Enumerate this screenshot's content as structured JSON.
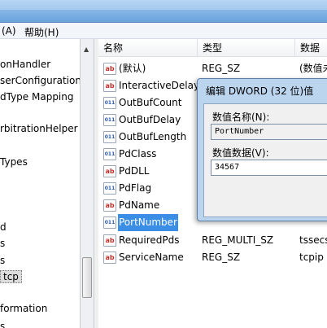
{
  "menu": {
    "items": [
      "(A)",
      "帮助(H)"
    ]
  },
  "tree": {
    "items": [
      "onHandler",
      "serConfiguration",
      "dType Mapping",
      "rbitrationHelper",
      "Types",
      "d",
      "s",
      "s",
      "tcp",
      "formation",
      "s"
    ],
    "selected_index": 8
  },
  "list": {
    "columns": [
      "名称",
      "类型",
      "数据"
    ],
    "rows": [
      {
        "icon": "string-value-icon",
        "name": "(默认)",
        "type": "REG_SZ",
        "data": "(数值未"
      },
      {
        "icon": "string-value-icon",
        "name": "InteractiveDelay",
        "type": "",
        "data": ""
      },
      {
        "icon": "binary-value-icon",
        "name": "OutBufCount",
        "type": "",
        "data": ""
      },
      {
        "icon": "binary-value-icon",
        "name": "OutBufDelay",
        "type": "",
        "data": ""
      },
      {
        "icon": "binary-value-icon",
        "name": "OutBufLength",
        "type": "",
        "data": ""
      },
      {
        "icon": "binary-value-icon",
        "name": "PdClass",
        "type": "",
        "data": ""
      },
      {
        "icon": "string-value-icon",
        "name": "PdDLL",
        "type": "",
        "data": ""
      },
      {
        "icon": "binary-value-icon",
        "name": "PdFlag",
        "type": "",
        "data": ""
      },
      {
        "icon": "string-value-icon",
        "name": "PdName",
        "type": "",
        "data": ""
      },
      {
        "icon": "binary-value-icon",
        "name": "PortNumber",
        "type": "",
        "data": ""
      },
      {
        "icon": "string-value-icon",
        "name": "RequiredPds",
        "type": "REG_MULTI_SZ",
        "data": "tssecs"
      },
      {
        "icon": "string-value-icon",
        "name": "ServiceName",
        "type": "REG_SZ",
        "data": "tcpip"
      }
    ],
    "selected_index": 9
  },
  "dialog": {
    "title": "编辑 DWORD (32 位)值",
    "name_label": "数值名称(N):",
    "name_value": "PortNumber",
    "data_label": "数值数据(V):",
    "data_value": "34567"
  },
  "colors": {
    "selection": "#3a8ee6",
    "dialog_frame": "#bcd5ee"
  }
}
